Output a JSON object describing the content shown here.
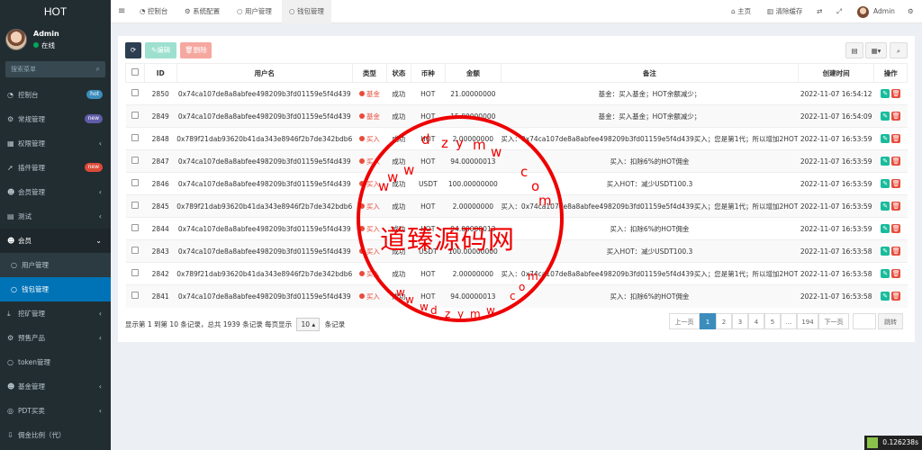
{
  "app_title": "HOT",
  "user": {
    "name": "Admin",
    "status": "在线"
  },
  "sidebar": {
    "search_placeholder": "搜索菜单",
    "items": [
      {
        "icon": "dashboard-icon",
        "label": "控制台",
        "badge": "hot",
        "badge_color": "#3c8dbc"
      },
      {
        "icon": "gear-icon",
        "label": "常规管理",
        "badge": "new",
        "badge_color": "#605ca8"
      },
      {
        "icon": "permission-icon",
        "label": "权限管理",
        "arrow": "‹"
      },
      {
        "icon": "rocket-icon",
        "label": "插件管理",
        "badge": "new",
        "badge_color": "#dd4b39"
      },
      {
        "icon": "member-icon",
        "label": "会员管理",
        "arrow": "‹"
      },
      {
        "icon": "test-icon",
        "label": "测试",
        "arrow": "‹"
      },
      {
        "icon": "member-icon",
        "label": "会员",
        "arrow": "‹"
      }
    ],
    "sub_items": [
      {
        "label": "用户管理"
      },
      {
        "label": "钱包管理"
      }
    ],
    "items2": [
      {
        "label": "挖矿管理",
        "arrow": "‹"
      },
      {
        "label": "预售产品",
        "arrow": "‹"
      },
      {
        "label": "token管理"
      },
      {
        "label": "基金管理",
        "arrow": "‹"
      },
      {
        "label": "PDT买卖",
        "arrow": "‹"
      },
      {
        "label": "佣金比例（代）"
      }
    ]
  },
  "topbar": {
    "tabs": [
      "控制台",
      "系统配置",
      "用户管理",
      "钱包管理"
    ],
    "right": [
      "主页",
      "清除缓存",
      "Admin"
    ]
  },
  "toolbar": {
    "refresh": "⟳",
    "edit": "编辑",
    "delete": "删除"
  },
  "table": {
    "headers": [
      "ID",
      "用户名",
      "类型",
      "状态",
      "币种",
      "金额",
      "备注",
      "创建时间",
      "操作"
    ],
    "rows": [
      [
        "2850",
        "0x74ca107de8a8abfee498209b3fd01159e5f4d439",
        "基金",
        "成功",
        "HOT",
        "21.00000000",
        "基金：买入基金；HOT余额减少；",
        "2022-11-07 16:54:12"
      ],
      [
        "2849",
        "0x74ca107de8a8abfee498209b3fd01159e5f4d439",
        "基金",
        "成功",
        "HOT",
        "15.00000000",
        "基金：买入基金；HOT余额减少；",
        "2022-11-07 16:54:09"
      ],
      [
        "2848",
        "0x789f21dab93620b41da343e8946f2b7de342bdb6",
        "买入",
        "成功",
        "HOT",
        "2.00000000",
        "买入：0x74ca107de8a8abfee498209b3fd01159e5f4d439买入；您是第1代；所以增加2HOT",
        "2022-11-07 16:53:59"
      ],
      [
        "2847",
        "0x74ca107de8a8abfee498209b3fd01159e5f4d439",
        "买入",
        "成功",
        "HOT",
        "94.00000013",
        "买入：扣除6%的HOT佣金",
        "2022-11-07 16:53:59"
      ],
      [
        "2846",
        "0x74ca107de8a8abfee498209b3fd01159e5f4d439",
        "买入",
        "成功",
        "USDT",
        "100.00000000",
        "买入HOT：减少USDT100.3",
        "2022-11-07 16:53:59"
      ],
      [
        "2845",
        "0x789f21dab93620b41da343e8946f2b7de342bdb6",
        "买入",
        "成功",
        "HOT",
        "2.00000000",
        "买入：0x74ca107de8a8abfee498209b3fd01159e5f4d439买入；您是第1代；所以增加2HOT",
        "2022-11-07 16:53:59"
      ],
      [
        "2844",
        "0x74ca107de8a8abfee498209b3fd01159e5f4d439",
        "买入",
        "成功",
        "HOT",
        "94.00000013",
        "买入：扣除6%的HOT佣金",
        "2022-11-07 16:53:59"
      ],
      [
        "2843",
        "0x74ca107de8a8abfee498209b3fd01159e5f4d439",
        "买入",
        "成功",
        "USDT",
        "100.00000000",
        "买入HOT：减少USDT100.3",
        "2022-11-07 16:53:58"
      ],
      [
        "2842",
        "0x789f21dab93620b41da343e8946f2b7de342bdb6",
        "买入",
        "成功",
        "HOT",
        "2.00000000",
        "买入：0x74ca107de8a8abfee498209b3fd01159e5f4d439买入；您是第1代；所以增加2HOT",
        "2022-11-07 16:53:58"
      ],
      [
        "2841",
        "0x74ca107de8a8abfee498209b3fd01159e5f4d439",
        "买入",
        "成功",
        "HOT",
        "94.00000013",
        "买入：扣除6%的HOT佣金",
        "2022-11-07 16:53:58"
      ]
    ]
  },
  "pagination": {
    "summary_a": "显示第 1 到第 10 条记录，总共 1939 条记录 每页显示",
    "page_size": "10",
    "summary_b": "条记录",
    "prev": "上一页",
    "pages": [
      "1",
      "2",
      "3",
      "4",
      "5",
      "...",
      "194"
    ],
    "next": "下一页",
    "jump": "跳转"
  },
  "watermark": {
    "text": "道臻源码网",
    "url": "www.dzymw.com"
  },
  "timer": "0.126238s",
  "colors": {
    "sidebar_bg": "#222d32",
    "primary": "#3c8dbc",
    "success": "#18bc9c",
    "danger": "#e74c3c"
  }
}
